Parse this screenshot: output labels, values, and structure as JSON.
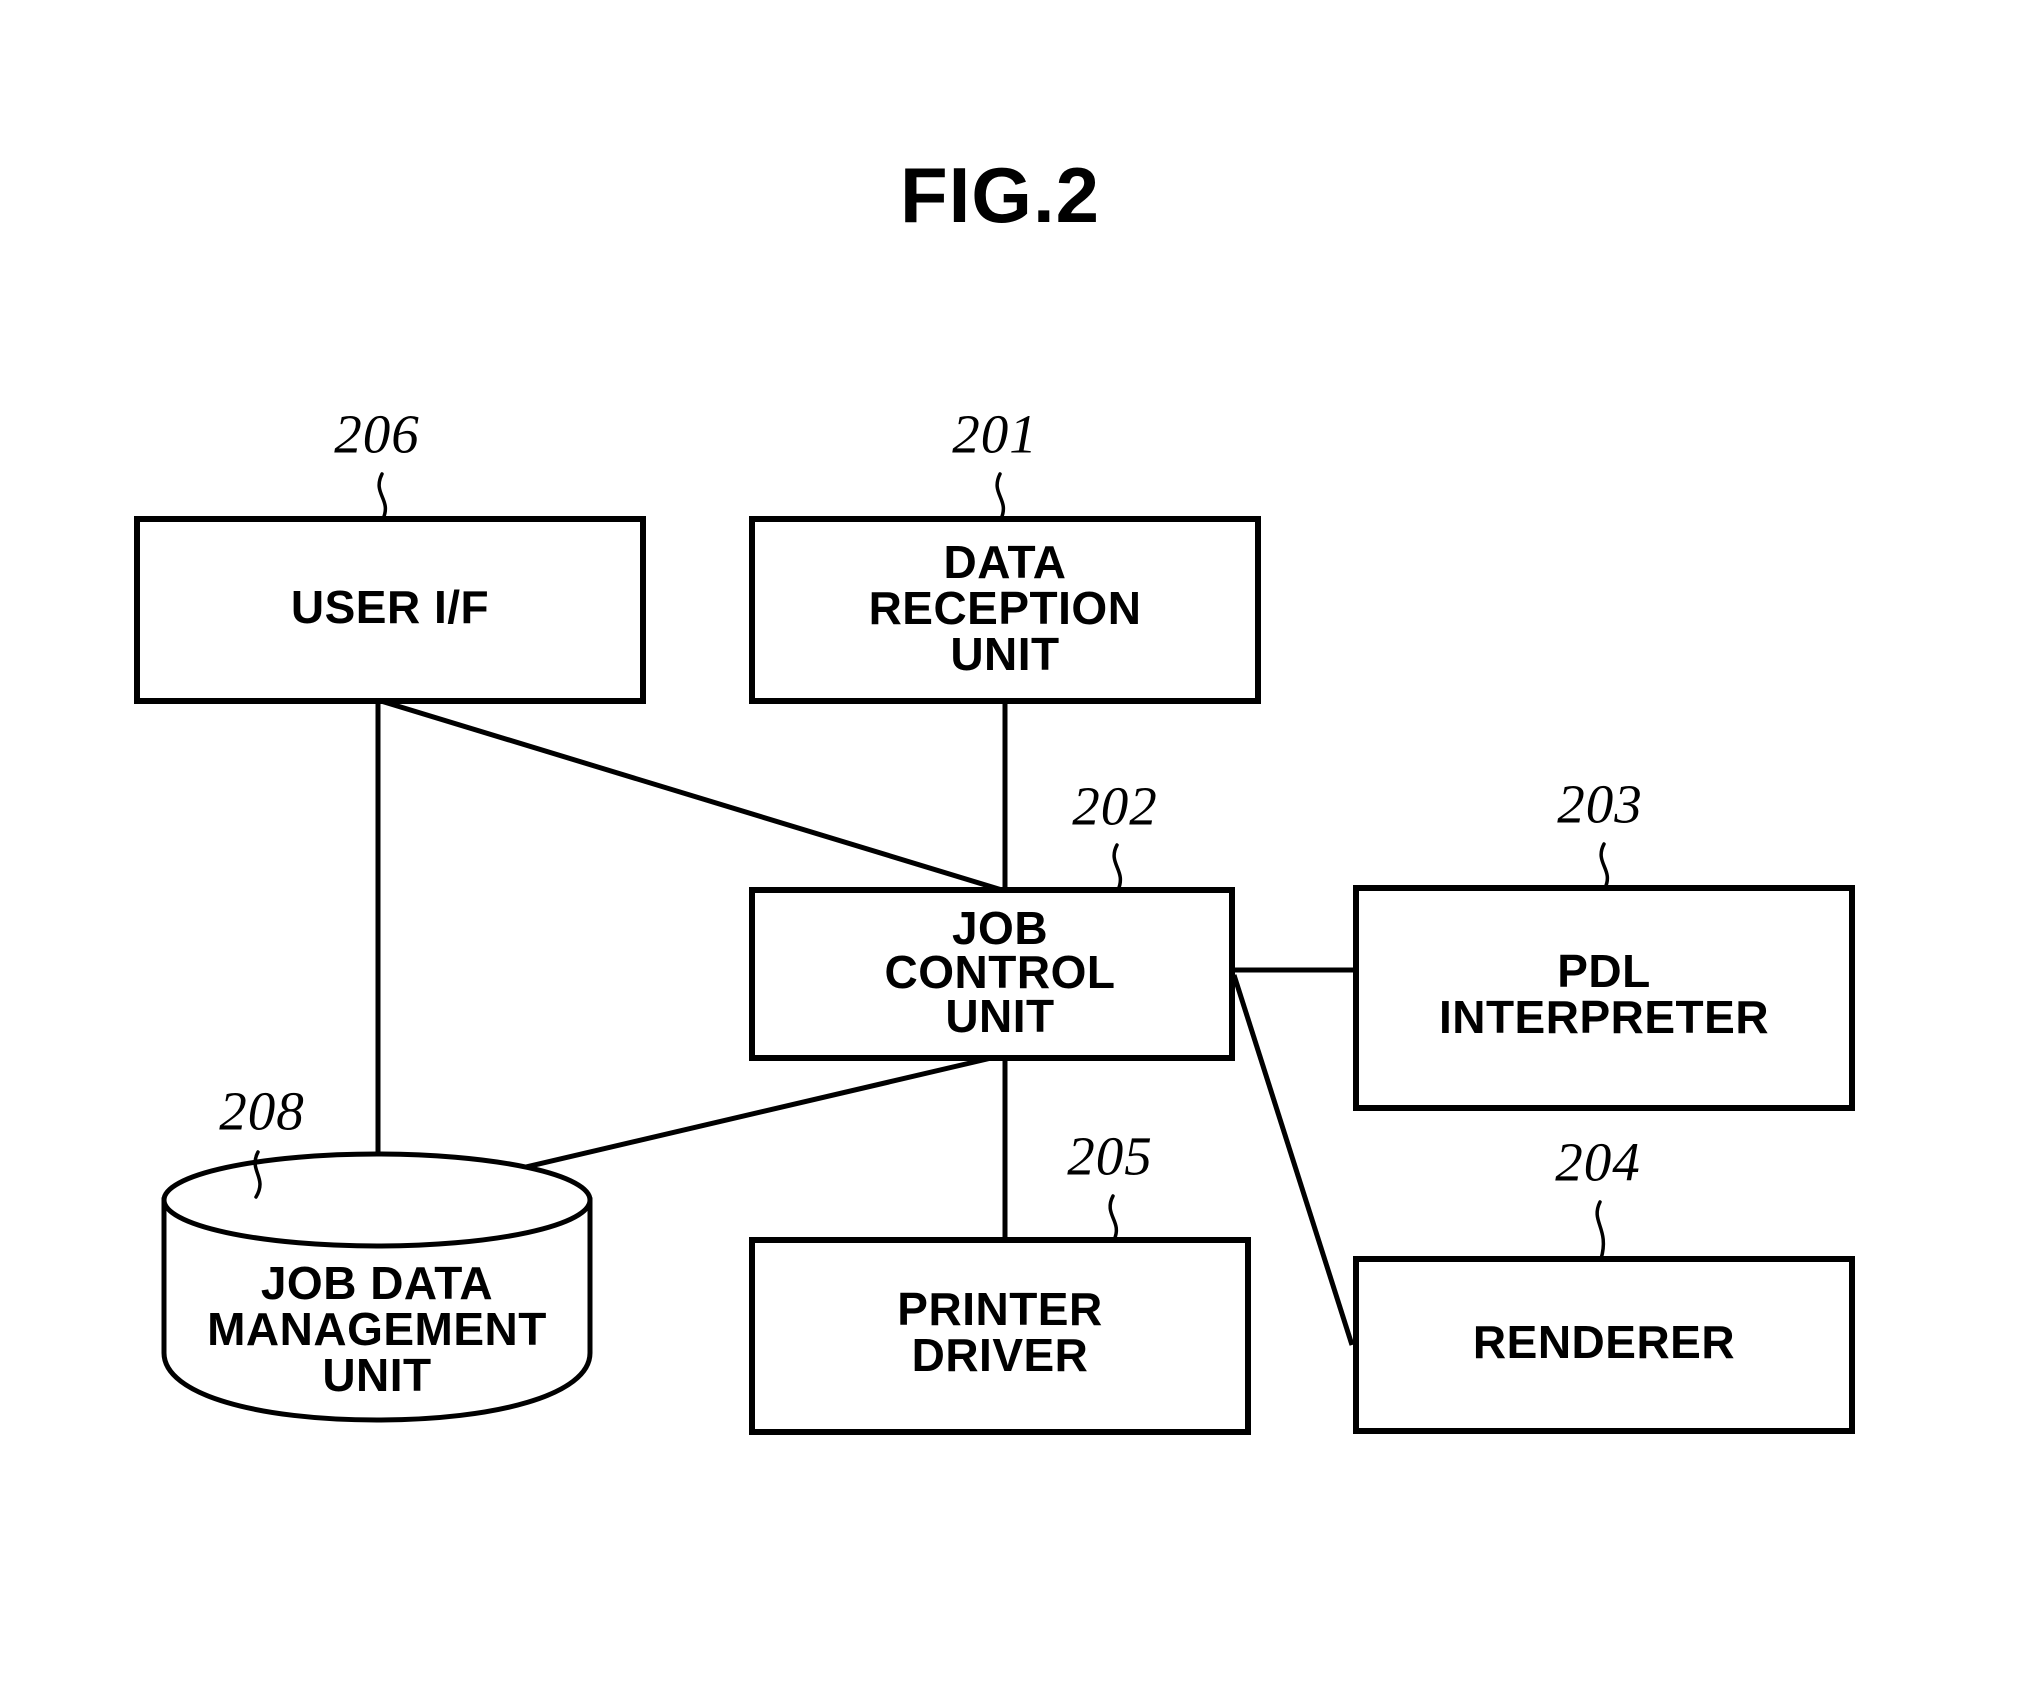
{
  "figure": {
    "title": "FIG.2",
    "type": "patent-block-diagram"
  },
  "blocks": {
    "user_if": {
      "ref": "206",
      "lines": [
        "USER I/F"
      ],
      "shape": "rectangle"
    },
    "data_reception_unit": {
      "ref": "201",
      "lines": [
        "DATA",
        "RECEPTION",
        "UNIT"
      ],
      "shape": "rectangle"
    },
    "job_control_unit": {
      "ref": "202",
      "lines": [
        "JOB",
        "CONTROL",
        "UNIT"
      ],
      "shape": "rectangle"
    },
    "pdl_interpreter": {
      "ref": "203",
      "lines": [
        "PDL",
        "INTERPRETER"
      ],
      "shape": "rectangle"
    },
    "renderer": {
      "ref": "204",
      "lines": [
        "RENDERER"
      ],
      "shape": "rectangle"
    },
    "printer_driver": {
      "ref": "205",
      "lines": [
        "PRINTER",
        "DRIVER"
      ],
      "shape": "rectangle"
    },
    "job_data_management_unit": {
      "ref": "208",
      "lines": [
        "JOB DATA",
        "MANAGEMENT",
        "UNIT"
      ],
      "shape": "cylinder"
    }
  },
  "connections": [
    {
      "name": "data-reception-to-job-control",
      "from": "data_reception_unit",
      "to": "job_control_unit",
      "style": "straight-vertical"
    },
    {
      "name": "user-if-to-job-control",
      "from": "user_if",
      "to": "job_control_unit",
      "style": "diagonal"
    },
    {
      "name": "user-if-to-job-data-management",
      "from": "user_if",
      "to": "job_data_management_unit",
      "style": "straight-vertical"
    },
    {
      "name": "job-control-to-job-data-management",
      "from": "job_control_unit",
      "to": "job_data_management_unit",
      "style": "diagonal"
    },
    {
      "name": "job-control-to-pdl-interpreter",
      "from": "job_control_unit",
      "to": "pdl_interpreter",
      "style": "straight-horizontal"
    },
    {
      "name": "job-control-to-renderer",
      "from": "job_control_unit",
      "to": "renderer",
      "style": "diagonal"
    },
    {
      "name": "job-control-to-printer-driver",
      "from": "job_control_unit",
      "to": "printer_driver",
      "style": "straight-vertical"
    }
  ],
  "colors": {
    "background": "#ffffff",
    "stroke": "#000000",
    "text": "#000000"
  }
}
